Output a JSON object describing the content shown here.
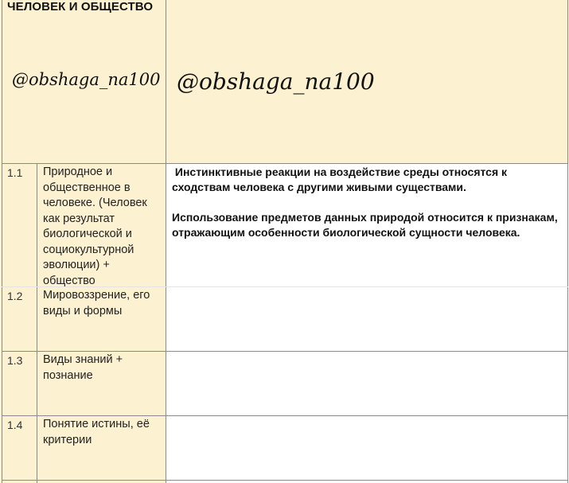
{
  "header": {
    "title": "ЧЕЛОВЕК И ОБЩЕСТВО",
    "watermark_left": "@obshaga_na100",
    "watermark_right": "@obshaga_na100"
  },
  "rows": [
    {
      "num": "1.1",
      "topic": "Природное и общественное в человеке. (Человек как результат биологической и социокультурной эволюции) + общество",
      "content": [
        " Инстинктивные реакции на воздействие среды относятся к сходствам человека с другими живыми существами.",
        "Использование предметов данных природой относится к признакам, отражающим особенности биологической сущности человека."
      ]
    },
    {
      "num": "1.2",
      "topic": "Мировоззрение, его виды и формы",
      "content": []
    },
    {
      "num": "1.3",
      "topic": "Виды знаний + познание",
      "content": []
    },
    {
      "num": "1.4",
      "topic": "Понятие истины, её критерии",
      "content": []
    }
  ],
  "colors": {
    "cream": "#fcf1d0",
    "grid": "#8a8a8a"
  }
}
